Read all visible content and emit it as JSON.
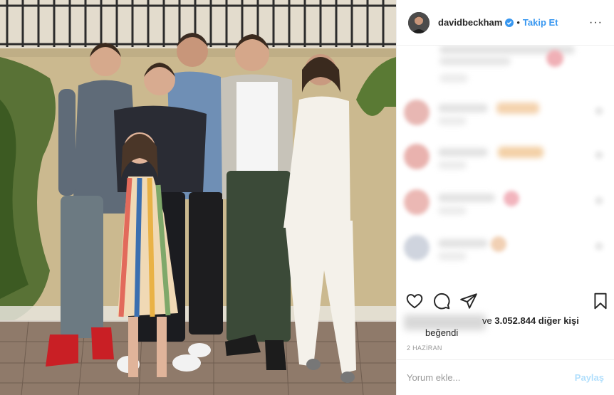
{
  "post": {
    "username": "davidbeckham",
    "separator": "•",
    "follow_label": "Takip Et",
    "more_label": "···",
    "likes_prefix": "ve",
    "likes_count_text": "3.052.844 diğer kişi",
    "likes_suffix": "beğendi",
    "date": "2 HAZİRAN",
    "comment_placeholder": "Yorum ekle...",
    "share_label": "Paylaş"
  },
  "colors": {
    "link_blue": "#3897f0",
    "share_disabled": "#b2dffc",
    "verified_blue": "#3897f0"
  },
  "icons": [
    "verified-badge-icon",
    "heart-icon",
    "comment-icon",
    "share-icon",
    "bookmark-icon",
    "more-options-icon"
  ]
}
